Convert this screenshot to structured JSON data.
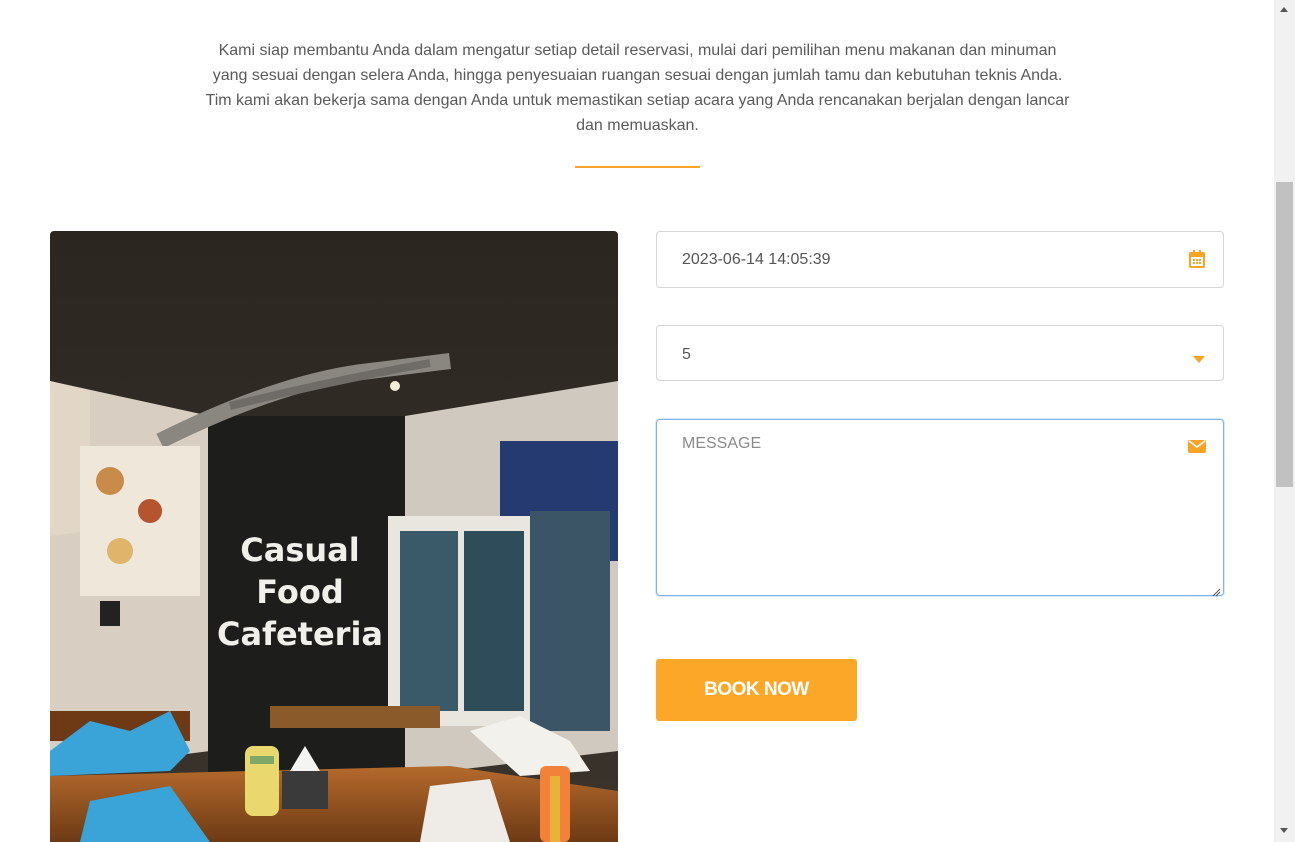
{
  "intro": {
    "line1": "Kami siap membantu Anda dalam mengatur setiap detail reservasi, mulai dari pemilihan menu makanan dan minuman",
    "line2": "yang sesuai dengan selera Anda, hingga penyesuaian ruangan sesuai dengan jumlah tamu dan kebutuhan teknis Anda.",
    "line3": "Tim kami akan bekerja sama dengan Anda untuk memastikan setiap acara yang Anda rencanakan berjalan dengan lancar",
    "line4": "dan memuaskan."
  },
  "photo": {
    "sign_line1": "Casual",
    "sign_line2": "Food",
    "sign_line3": "Cafeteria"
  },
  "form": {
    "datetime_value": "2023-06-14 14:05:39",
    "guests_value": "5",
    "message_placeholder": "MESSAGE",
    "book_label": "BOOK NOW"
  },
  "icons": {
    "date": "calendar-icon",
    "select": "caret-down-icon",
    "message": "envelope-icon"
  },
  "colors": {
    "accent": "#fca728",
    "divider": "#f7a325",
    "focus_border": "#7fb5ea"
  }
}
